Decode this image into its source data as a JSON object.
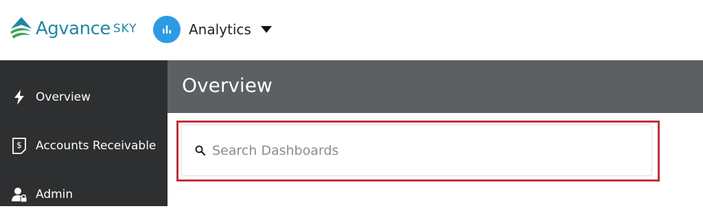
{
  "topbar": {
    "logo": {
      "brand": "Agvance",
      "brand_suffix": "SKY",
      "brand_color": "#1f87a6",
      "icon": "agvance-leaf-icon"
    },
    "app_switcher": {
      "label": "Analytics",
      "icon": "bar-chart-icon",
      "icon_bg": "#2c9be3",
      "caret": "caret-down-icon"
    }
  },
  "sidebar": {
    "bg_color": "#2d2f31",
    "items": [
      {
        "label": "Overview",
        "icon": "lightning-bolt-icon"
      },
      {
        "label": "Accounts Receivable",
        "icon": "invoice-dollar-icon"
      },
      {
        "label": "Admin",
        "icon": "user-lock-icon"
      }
    ]
  },
  "main": {
    "header_bg": "#5d6063",
    "title": "Overview",
    "search": {
      "placeholder": "Search Dashboards",
      "value": "",
      "icon": "search-icon"
    },
    "highlight_color": "#c0303a"
  }
}
